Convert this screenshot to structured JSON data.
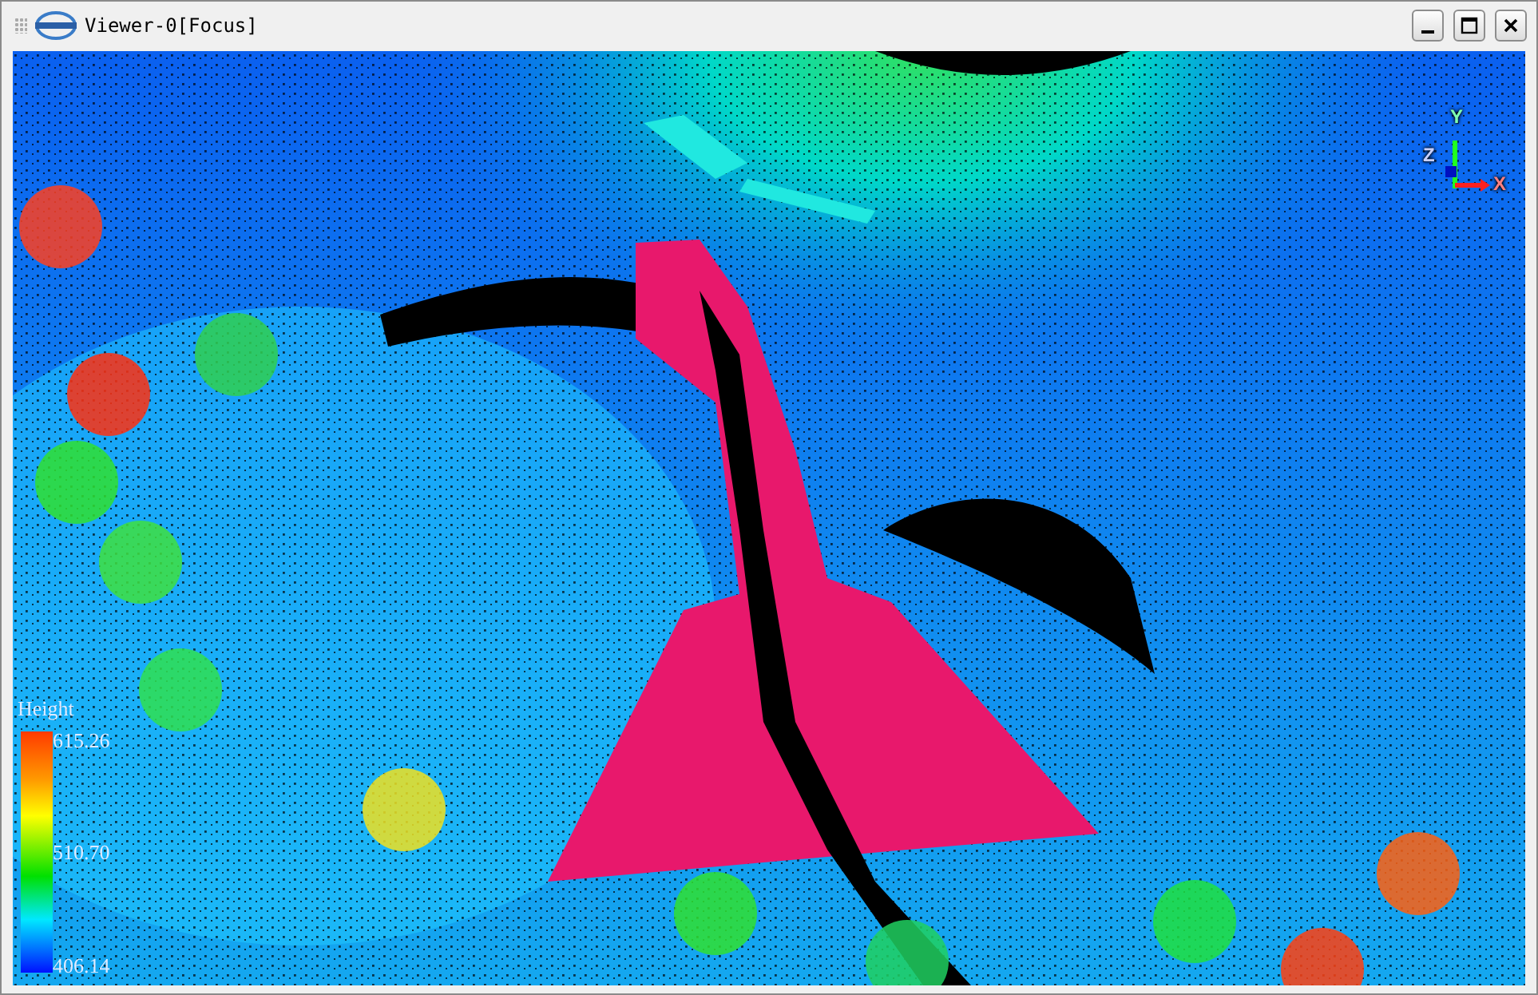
{
  "window": {
    "title": "Viewer-0[Focus]"
  },
  "viewer": {
    "axes": {
      "x_label": "X",
      "y_label": "Y",
      "z_label": "Z"
    },
    "legend": {
      "title": "Height",
      "max": "615.26",
      "mid": "510.70",
      "min": "406.14"
    }
  }
}
